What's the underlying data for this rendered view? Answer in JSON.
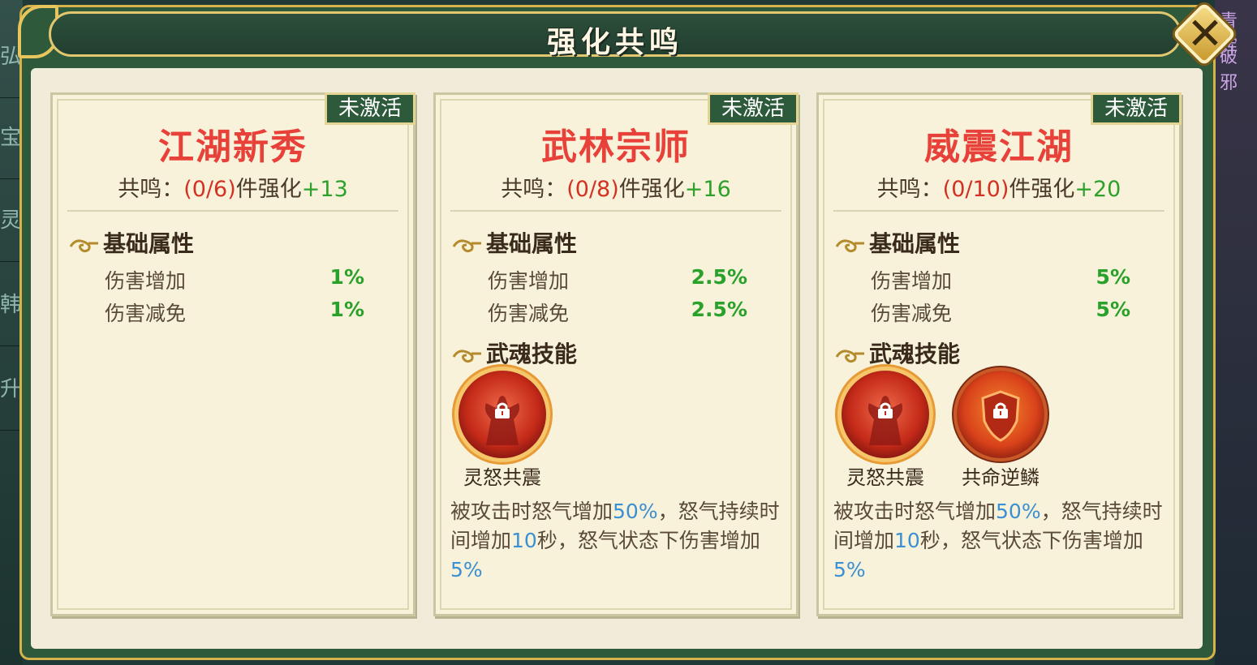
{
  "window": {
    "title": "强化共鸣"
  },
  "background_tabs": [
    "弘",
    "宝",
    "灵",
    "韩",
    "升"
  ],
  "background_right": [
    "青辉",
    "破邪"
  ],
  "close": {
    "icon": "close-icon"
  },
  "cards": [
    {
      "badge": "未激活",
      "name": "江湖新秀",
      "resonance_prefix": "共鸣：",
      "resonance_count": "(0/6)",
      "resonance_mid": "件强化",
      "resonance_bonus": "+13",
      "base_title": "基础属性",
      "attrs": [
        {
          "label": "伤害增加",
          "value": "1%"
        },
        {
          "label": "伤害减免",
          "value": "1%"
        }
      ]
    },
    {
      "badge": "未激活",
      "name": "武林宗师",
      "resonance_prefix": "共鸣：",
      "resonance_count": "(0/8)",
      "resonance_mid": "件强化",
      "resonance_bonus": "+16",
      "base_title": "基础属性",
      "attrs": [
        {
          "label": "伤害增加",
          "value": "2.5%"
        },
        {
          "label": "伤害减免",
          "value": "2.5%"
        }
      ],
      "skill_title": "武魂技能",
      "skills": [
        {
          "name": "灵怒共震",
          "icon": "rage-figure-icon"
        }
      ],
      "desc": {
        "p1": "被攻击时怒气增加",
        "v1": "50%",
        "p2": "，怒气持续时间增加",
        "v2": "10",
        "p3": "秒，怒气状态下伤害增加",
        "v3": "5%"
      }
    },
    {
      "badge": "未激活",
      "name": "威震江湖",
      "resonance_prefix": "共鸣：",
      "resonance_count": "(0/10)",
      "resonance_mid": "件强化",
      "resonance_bonus": "+20",
      "base_title": "基础属性",
      "attrs": [
        {
          "label": "伤害增加",
          "value": "5%"
        },
        {
          "label": "伤害减免",
          "value": "5%"
        }
      ],
      "skill_title": "武魂技能",
      "skills": [
        {
          "name": "灵怒共震",
          "icon": "rage-figure-icon"
        },
        {
          "name": "共命逆鳞",
          "icon": "shield-swirl-icon"
        }
      ],
      "desc": {
        "p1": "被攻击时怒气增加",
        "v1": "50%",
        "p2": "，怒气持续时间增加",
        "v2": "10",
        "p3": "秒，怒气状态下伤害增加",
        "v3": "5%"
      }
    }
  ],
  "colors": {
    "frame_green": "#2e5a3b",
    "gold": "#e3c770",
    "card_bg": "#f7f2d9",
    "name_red": "#e8413a",
    "value_green": "#2aa12a",
    "highlight_blue": "#3b8fd3"
  }
}
